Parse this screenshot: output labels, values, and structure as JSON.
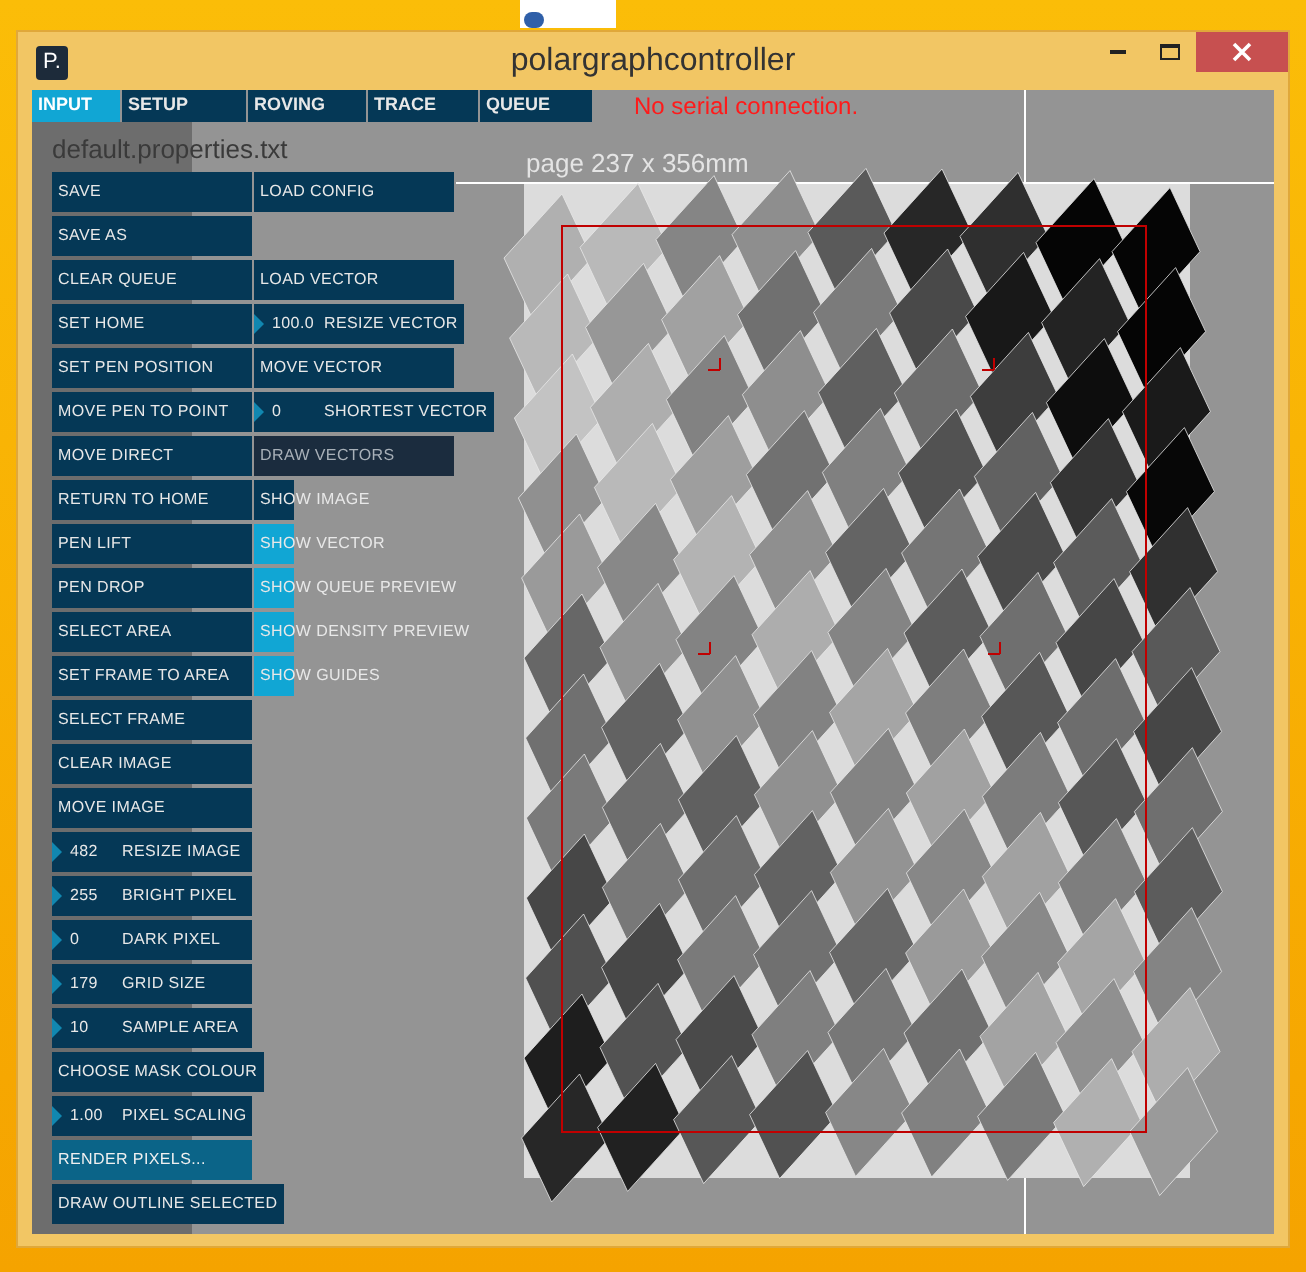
{
  "window": {
    "icon_text": "P.",
    "title": "polargraphcontroller"
  },
  "tabs": [
    {
      "label": "INPUT",
      "selected": true
    },
    {
      "label": "SETUP",
      "selected": false
    },
    {
      "label": "ROVING",
      "selected": false
    },
    {
      "label": "TRACE",
      "selected": false
    },
    {
      "label": "QUEUE",
      "selected": false
    }
  ],
  "status": "No serial connection.",
  "filename": "default.properties.txt",
  "page_label": "page 237 x 356mm",
  "left_controls": [
    {
      "kind": "button",
      "label": "SAVE",
      "highlighted": false
    },
    {
      "kind": "button",
      "label": "SAVE AS",
      "highlighted": false
    },
    {
      "kind": "button",
      "label": "CLEAR QUEUE",
      "highlighted": false
    },
    {
      "kind": "button",
      "label": "SET HOME",
      "highlighted": false
    },
    {
      "kind": "button",
      "label": "SET PEN POSITION",
      "highlighted": false
    },
    {
      "kind": "button",
      "label": "MOVE PEN TO POINT",
      "highlighted": false
    },
    {
      "kind": "button",
      "label": "MOVE DIRECT",
      "highlighted": false
    },
    {
      "kind": "button",
      "label": "RETURN TO HOME",
      "highlighted": false
    },
    {
      "kind": "button",
      "label": "PEN LIFT",
      "highlighted": false
    },
    {
      "kind": "button",
      "label": "PEN DROP",
      "highlighted": false
    },
    {
      "kind": "button",
      "label": "SELECT AREA",
      "highlighted": false
    },
    {
      "kind": "button",
      "label": "SET FRAME TO AREA",
      "highlighted": false
    },
    {
      "kind": "button",
      "label": "SELECT FRAME",
      "highlighted": false
    },
    {
      "kind": "button",
      "label": "CLEAR IMAGE",
      "highlighted": false
    },
    {
      "kind": "button",
      "label": "MOVE IMAGE",
      "highlighted": false
    },
    {
      "kind": "number",
      "value": "482",
      "label": "RESIZE IMAGE"
    },
    {
      "kind": "number",
      "value": "255",
      "label": "BRIGHT PIXEL"
    },
    {
      "kind": "number",
      "value": "0",
      "label": "DARK PIXEL"
    },
    {
      "kind": "number",
      "value": "179",
      "label": "GRID SIZE"
    },
    {
      "kind": "number",
      "value": "10",
      "label": "SAMPLE AREA"
    },
    {
      "kind": "button",
      "label": "CHOOSE MASK COLOUR",
      "highlighted": false
    },
    {
      "kind": "number",
      "value": "1.00",
      "label": "PIXEL SCALING"
    },
    {
      "kind": "button",
      "label": "RENDER PIXELS...",
      "highlighted": true
    },
    {
      "kind": "button",
      "label": "DRAW OUTLINE SELECTED",
      "highlighted": false
    }
  ],
  "right_top_control": {
    "kind": "button",
    "label": "LOAD CONFIG",
    "disabled": false
  },
  "right_controls": [
    {
      "kind": "button",
      "label": "LOAD VECTOR",
      "disabled": false
    },
    {
      "kind": "number",
      "value": "100.0",
      "label": "RESIZE VECTOR"
    },
    {
      "kind": "button",
      "label": "MOVE VECTOR",
      "disabled": false
    },
    {
      "kind": "number",
      "value": "0",
      "label": "SHORTEST VECTOR"
    },
    {
      "kind": "button",
      "label": "DRAW VECTORS",
      "disabled": true
    },
    {
      "kind": "toggle",
      "label": "SHOW IMAGE",
      "on": false
    },
    {
      "kind": "toggle",
      "label": "SHOW VECTOR",
      "on": true
    },
    {
      "kind": "toggle",
      "label": "SHOW QUEUE PREVIEW",
      "on": true
    },
    {
      "kind": "toggle",
      "label": "SHOW DENSITY PREVIEW",
      "on": true
    },
    {
      "kind": "toggle",
      "label": "SHOW GUIDES",
      "on": true
    }
  ]
}
